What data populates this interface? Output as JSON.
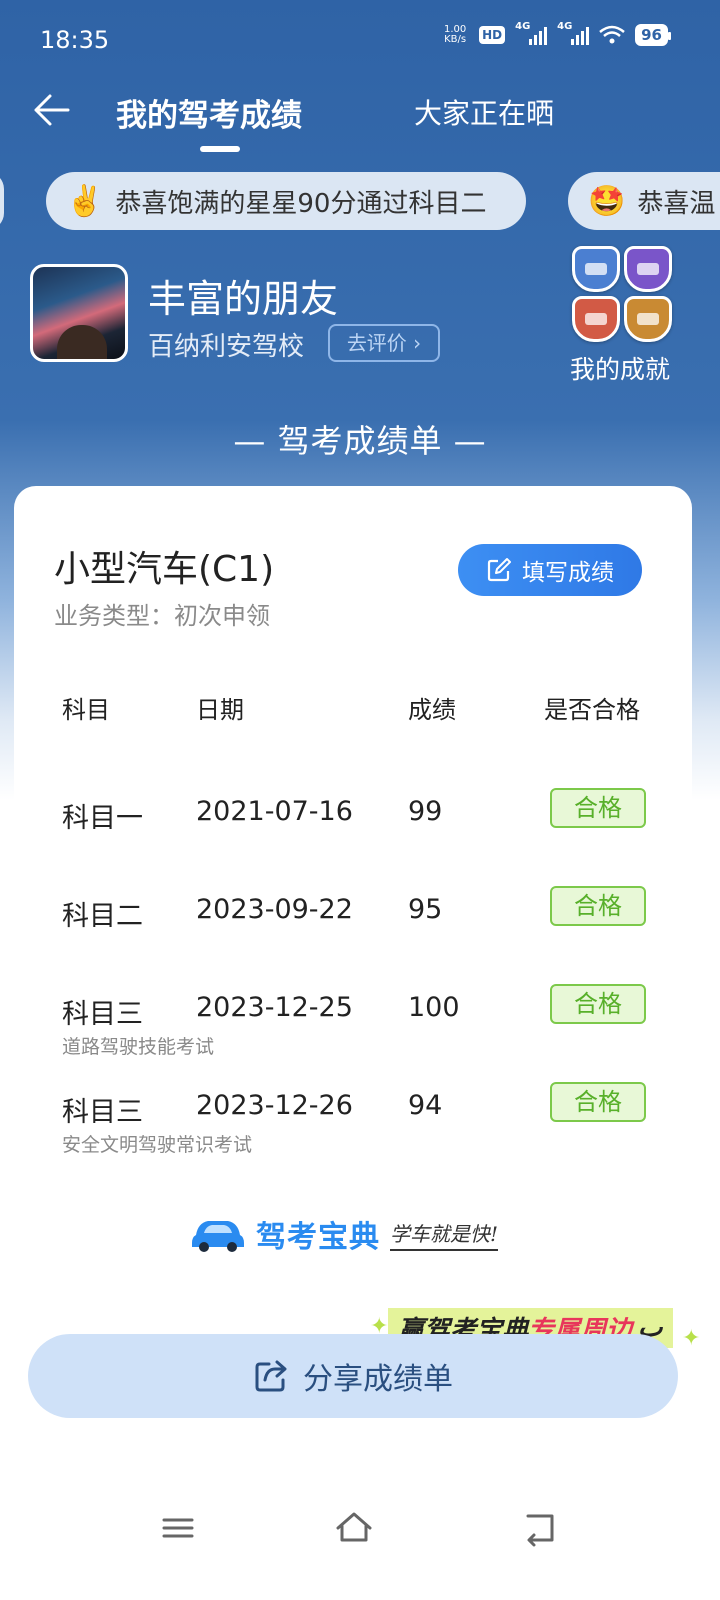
{
  "status": {
    "time": "18:35",
    "net_speed_value": "1.00",
    "net_speed_unit": "KB/s",
    "hd": "HD",
    "signal1": "4G",
    "signal2": "4G",
    "battery": "96"
  },
  "nav": {
    "tab_active": "我的驾考成绩",
    "tab_other": "大家正在晒"
  },
  "ticker": {
    "main": {
      "emoji": "✌️",
      "text": "恭喜饱满的星星90分通过科目二"
    },
    "next": {
      "emoji": "🤩",
      "text": "恭喜温"
    }
  },
  "profile": {
    "name": "丰富的朋友",
    "school": "百纳利安驾校",
    "rate_label": "去评价"
  },
  "achievements": {
    "label": "我的成就"
  },
  "section_title": "— 驾考成绩单 —",
  "card": {
    "license": "小型汽车(C1)",
    "biz_type": "业务类型：初次申领",
    "fill_button": "填写成绩",
    "headers": [
      "科目",
      "日期",
      "成绩",
      "是否合格"
    ],
    "rows": [
      {
        "subject": "科目一",
        "date": "2021-07-16",
        "score": "99",
        "result": "合格",
        "note": ""
      },
      {
        "subject": "科目二",
        "date": "2023-09-22",
        "score": "95",
        "result": "合格",
        "note": ""
      },
      {
        "subject": "科目三",
        "date": "2023-12-25",
        "score": "100",
        "result": "合格",
        "note": "道路驾驶技能考试"
      },
      {
        "subject": "科目三",
        "date": "2023-12-26",
        "score": "94",
        "result": "合格",
        "note": "安全文明驾驶常识考试"
      }
    ],
    "brand_name": "驾考宝典",
    "brand_slogan": "学车就是快!"
  },
  "promo": {
    "part1": "赢驾考宝典",
    "part2": "专属周边"
  },
  "share_button": "分享成绩单",
  "colors": {
    "primary": "#2f63a6",
    "accent": "#2f79e6",
    "pass": "#58b02a"
  }
}
